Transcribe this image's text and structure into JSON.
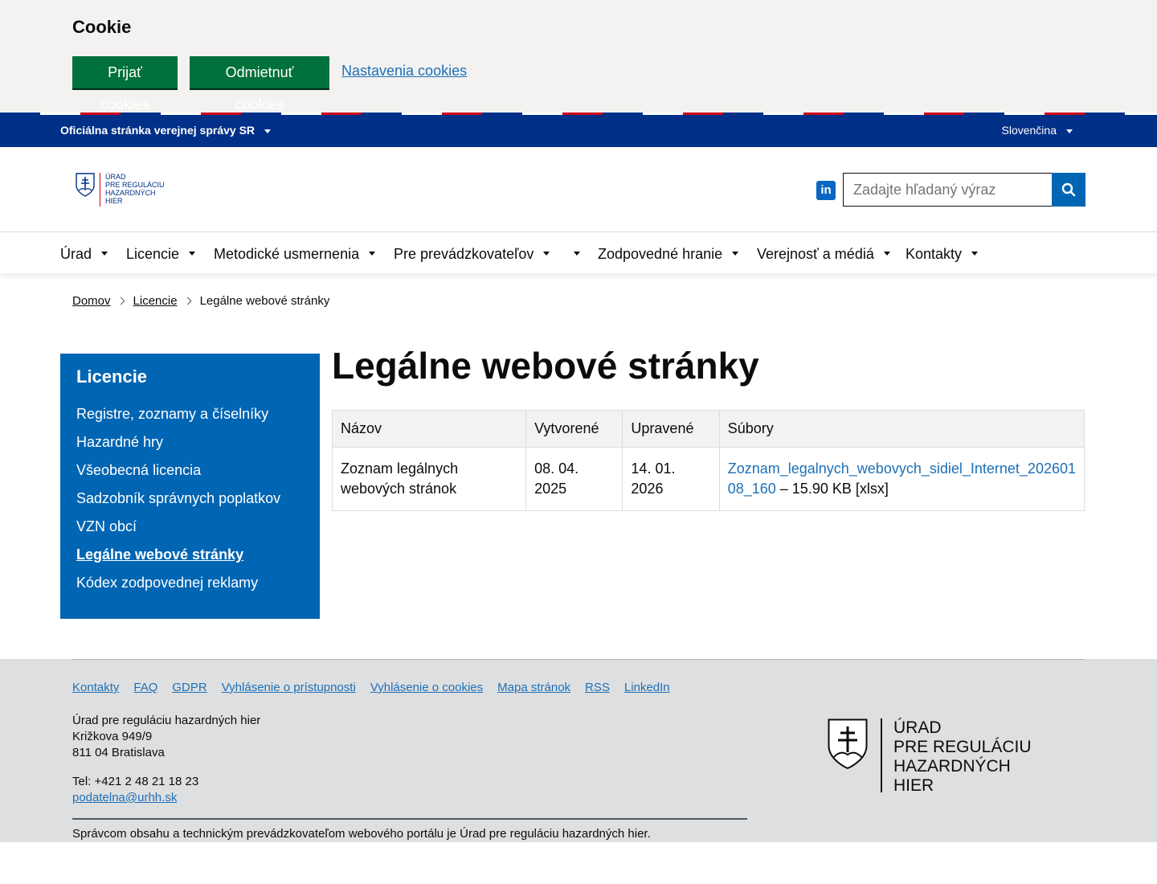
{
  "cookie": {
    "title": "Cookie",
    "accept_label": "Prijať cookies",
    "reject_label": "Odmietnuť cookies",
    "settings_label": "Nastavenia cookies"
  },
  "govbar": {
    "official_label": "Oficiálna stránka verejnej správy SR",
    "language": "Slovenčina"
  },
  "header": {
    "logo_lines": [
      "ÚRAD",
      "PRE REGULÁCIU",
      "HAZARDNÝCH",
      "HIER"
    ],
    "linkedin_icon_text": "in",
    "search_placeholder": "Zadajte hľadaný výraz"
  },
  "nav": {
    "items": [
      "Úrad",
      "Licencie",
      "Metodické usmernenia",
      "Pre prevádzkovateľov",
      "Zodpovedné hranie",
      "Verejnosť a médiá",
      "Kontakty"
    ]
  },
  "breadcrumb": {
    "items": [
      "Domov",
      "Licencie",
      "Legálne webové stránky"
    ]
  },
  "sidebar": {
    "title": "Licencie",
    "items": [
      "Registre, zoznamy a číselníky",
      "Hazardné hry",
      "Všeobecná licencia",
      "Sadzobník správnych poplatkov",
      "VZN obcí",
      "Legálne webové stránky",
      "Kódex zodpovednej reklamy"
    ]
  },
  "main": {
    "title": "Legálne webové stránky",
    "table": {
      "headers": [
        "Názov",
        "Vytvorené",
        "Upravené",
        "Súbory"
      ],
      "rows": [
        {
          "name": "Zoznam legálnych webových stránok",
          "created": "08. 04. 2025",
          "updated": "14. 01. 2026",
          "file_link": "Zoznam_legalnych_webovych_sidiel_Internet_202601 08_160",
          "file_meta": " – 15.90 KB [xlsx]"
        }
      ]
    }
  },
  "footer": {
    "links": [
      "Kontakty",
      "FAQ",
      "GDPR",
      "Vyhlásenie o prístupnosti",
      "Vyhlásenie o cookies",
      "Mapa stránok",
      "RSS",
      "LinkedIn"
    ],
    "org": "Úrad pre reguláciu hazardných hier",
    "street": "Križkova 949/9",
    "city": "811 04 Bratislava",
    "phone": "Tel: +421 2 48 21 18 23",
    "email": "podatelna@urhh.sk",
    "note": "Správcom obsahu a technickým prevádzkovateľom webového portálu je Úrad pre reguláciu hazardných hier.",
    "logo_lines": [
      "ÚRAD",
      "PRE REGULÁCIU",
      "HAZARDNÝCH",
      "HIER"
    ]
  }
}
